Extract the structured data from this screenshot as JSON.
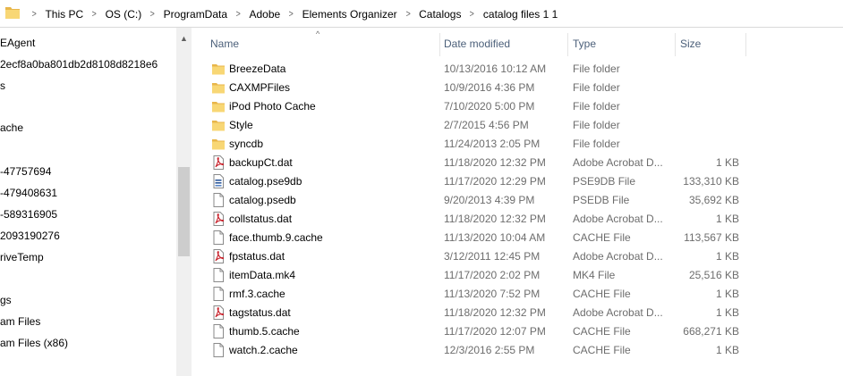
{
  "address_bar": {
    "breadcrumbs": [
      "This PC",
      "OS (C:)",
      "ProgramData",
      "Adobe",
      "Elements Organizer",
      "Catalogs",
      "catalog files 1 1"
    ]
  },
  "nav_pane": {
    "items": [
      {
        "label": "EAgent"
      },
      {
        "label": "2ecf8a0ba801db2d8108d8218e6"
      },
      {
        "label": "s"
      },
      {
        "label": "ache"
      },
      {
        "label": "-47757694"
      },
      {
        "label": "-479408631"
      },
      {
        "label": "-589316905"
      },
      {
        "label": "2093190276"
      },
      {
        "label": "riveTemp"
      },
      {
        "label": "gs"
      },
      {
        "label": "am Files"
      },
      {
        "label": "am Files (x86)"
      }
    ]
  },
  "columns": {
    "name": "Name",
    "date": "Date modified",
    "type": "Type",
    "size": "Size"
  },
  "files": [
    {
      "name": "BreezeData",
      "date": "10/13/2016 10:12 AM",
      "type": "File folder",
      "size": "",
      "icon": "folder-icon"
    },
    {
      "name": "CAXMPFiles",
      "date": "10/9/2016 4:36 PM",
      "type": "File folder",
      "size": "",
      "icon": "folder-icon"
    },
    {
      "name": "iPod Photo Cache",
      "date": "7/10/2020 5:00 PM",
      "type": "File folder",
      "size": "",
      "icon": "folder-icon"
    },
    {
      "name": "Style",
      "date": "2/7/2015 4:56 PM",
      "type": "File folder",
      "size": "",
      "icon": "folder-icon"
    },
    {
      "name": "syncdb",
      "date": "11/24/2013 2:05 PM",
      "type": "File folder",
      "size": "",
      "icon": "folder-icon"
    },
    {
      "name": "backupCt.dat",
      "date": "11/18/2020 12:32 PM",
      "type": "Adobe Acrobat D...",
      "size": "1 KB",
      "icon": "pdf-file-icon"
    },
    {
      "name": "catalog.pse9db",
      "date": "11/17/2020 12:29 PM",
      "type": "PSE9DB File",
      "size": "133,310 KB",
      "icon": "database-file-icon"
    },
    {
      "name": "catalog.psedb",
      "date": "9/20/2013 4:39 PM",
      "type": "PSEDB File",
      "size": "35,692 KB",
      "icon": "blank-file-icon"
    },
    {
      "name": "collstatus.dat",
      "date": "11/18/2020 12:32 PM",
      "type": "Adobe Acrobat D...",
      "size": "1 KB",
      "icon": "pdf-file-icon"
    },
    {
      "name": "face.thumb.9.cache",
      "date": "11/13/2020 10:04 AM",
      "type": "CACHE File",
      "size": "113,567 KB",
      "icon": "blank-file-icon"
    },
    {
      "name": "fpstatus.dat",
      "date": "3/12/2011 12:45 PM",
      "type": "Adobe Acrobat D...",
      "size": "1 KB",
      "icon": "pdf-file-icon"
    },
    {
      "name": "itemData.mk4",
      "date": "11/17/2020 2:02 PM",
      "type": "MK4 File",
      "size": "25,516 KB",
      "icon": "blank-file-icon"
    },
    {
      "name": "rmf.3.cache",
      "date": "11/13/2020 7:52 PM",
      "type": "CACHE File",
      "size": "1 KB",
      "icon": "blank-file-icon"
    },
    {
      "name": "tagstatus.dat",
      "date": "11/18/2020 12:32 PM",
      "type": "Adobe Acrobat D...",
      "size": "1 KB",
      "icon": "pdf-file-icon"
    },
    {
      "name": "thumb.5.cache",
      "date": "11/17/2020 12:07 PM",
      "type": "CACHE File",
      "size": "668,271 KB",
      "icon": "blank-file-icon"
    },
    {
      "name": "watch.2.cache",
      "date": "12/3/2016 2:55 PM",
      "type": "CACHE File",
      "size": "1 KB",
      "icon": "blank-file-icon"
    }
  ],
  "colors": {
    "folder": "#f8d775",
    "folder_dark": "#e8b64a",
    "pdf_red": "#c8202a",
    "header_text": "#4c607a",
    "secondary_text": "#6d6d6d"
  }
}
